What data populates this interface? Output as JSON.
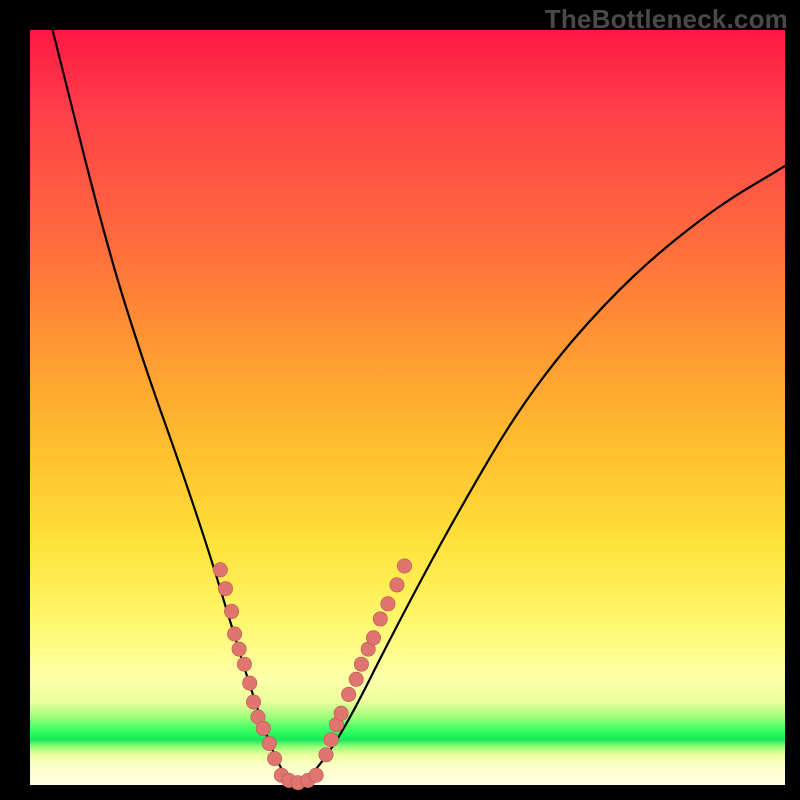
{
  "watermark": {
    "text": "TheBottleneck.com"
  },
  "colors": {
    "dot_fill": "#e0746e",
    "dot_stroke": "#b85a54",
    "curve": "#000000"
  },
  "chart_data": {
    "type": "line",
    "title": "",
    "xlabel": "",
    "ylabel": "",
    "xlim": [
      0,
      100
    ],
    "ylim": [
      0,
      100
    ],
    "grid": false,
    "legend": false,
    "series": [
      {
        "name": "curve",
        "x": [
          3,
          10,
          15,
          20,
          24,
          27,
          29.5,
          31.5,
          33.5,
          35.5,
          38,
          42,
          48,
          56,
          66,
          78,
          90,
          100
        ],
        "y": [
          100,
          72,
          56,
          42,
          30,
          20,
          12,
          6,
          1.5,
          0,
          2,
          8,
          20,
          35,
          52,
          66,
          76,
          82
        ]
      }
    ],
    "points_left": [
      {
        "x": 25.2,
        "y": 28.5
      },
      {
        "x": 25.9,
        "y": 26.0
      },
      {
        "x": 26.7,
        "y": 23.0
      },
      {
        "x": 27.1,
        "y": 20.0
      },
      {
        "x": 27.7,
        "y": 18.0
      },
      {
        "x": 28.4,
        "y": 16.0
      },
      {
        "x": 29.1,
        "y": 13.5
      },
      {
        "x": 29.6,
        "y": 11.0
      },
      {
        "x": 30.2,
        "y": 9.0
      },
      {
        "x": 30.9,
        "y": 7.5
      },
      {
        "x": 31.7,
        "y": 5.5
      },
      {
        "x": 32.4,
        "y": 3.5
      }
    ],
    "points_bottom": [
      {
        "x": 33.3,
        "y": 1.3
      },
      {
        "x": 34.3,
        "y": 0.6
      },
      {
        "x": 35.5,
        "y": 0.3
      },
      {
        "x": 36.8,
        "y": 0.6
      },
      {
        "x": 37.9,
        "y": 1.3
      }
    ],
    "points_right": [
      {
        "x": 39.2,
        "y": 4.0
      },
      {
        "x": 39.9,
        "y": 6.0
      },
      {
        "x": 40.6,
        "y": 8.0
      },
      {
        "x": 41.2,
        "y": 9.5
      },
      {
        "x": 42.2,
        "y": 12.0
      },
      {
        "x": 43.2,
        "y": 14.0
      },
      {
        "x": 43.9,
        "y": 16.0
      },
      {
        "x": 44.8,
        "y": 18.0
      },
      {
        "x": 45.5,
        "y": 19.5
      },
      {
        "x": 46.4,
        "y": 22.0
      },
      {
        "x": 47.4,
        "y": 24.0
      },
      {
        "x": 48.6,
        "y": 26.5
      },
      {
        "x": 49.6,
        "y": 29.0
      }
    ]
  }
}
